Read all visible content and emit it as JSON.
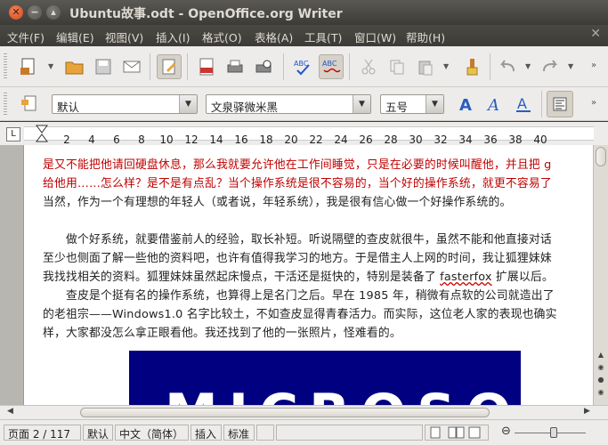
{
  "window": {
    "title": "Ubuntu故事.odt - OpenOffice.org Writer",
    "close_glyph": "✕",
    "minimize_glyph": "−",
    "maximize_glyph": "▴"
  },
  "menubar": {
    "items": [
      "文件(F)",
      "编辑(E)",
      "视图(V)",
      "插入(I)",
      "格式(O)",
      "表格(A)",
      "工具(T)",
      "窗口(W)",
      "帮助(H)"
    ],
    "close_glyph": "✕"
  },
  "formatting": {
    "paragraph_style": "默认",
    "font_name": "文泉驿微米黑",
    "font_size": "五号"
  },
  "ruler": {
    "marks": [
      "2",
      "4",
      "6",
      "8",
      "10",
      "12",
      "14",
      "16",
      "18",
      "20",
      "22",
      "24",
      "26",
      "28",
      "30",
      "32",
      "34",
      "36",
      "38",
      "40"
    ]
  },
  "document": {
    "lines": [
      {
        "text": "是又不能把他请回硬盘休息，那么我就要允许他在工作间睡觉，只是在必要的时候叫醒他，并且把 g",
        "color": "red"
      },
      {
        "text": "给他用……怎么样？是不是有点乱？当个操作系统是很不容易的，当个好的操作系统，就更不容易了",
        "color": "red"
      },
      {
        "text": "当然，作为一个有理想的年轻人（或者说，年轻系统），我是很有信心做一个好操作系统的。",
        "color": "black"
      },
      {
        "text": "",
        "color": "black"
      },
      {
        "text": "　　做个好系统，就要借鉴前人的经验，取长补短。听说隔壁的查皮就很牛，虽然不能和他直接对话",
        "color": "black"
      },
      {
        "text": "至少也侧面了解一些他的资料吧，也许有值得我学习的地方。于是借主人上网的时间，我让狐狸妹妹",
        "color": "black"
      },
      {
        "text_before": "我找找相关的资料。狐狸妹妹虽然起床慢点，干活还是挺快的，特别是装备了 ",
        "text_link": "fasterfox",
        "text_after": " 扩展以后。",
        "color": "black"
      },
      {
        "text": "　　查皮是个挺有名的操作系统，也算得上是名门之后。早在 1985 年，稍微有点软的公司就造出了",
        "color": "black"
      },
      {
        "text": "的老祖宗——Windows1.0 名字比较土，不如查皮显得青春活力。而实际，这位老人家的表现也确实",
        "color": "black"
      },
      {
        "text": "样，大家都没怎么拿正眼看他。我还找到了他的一张照片，怪难看的。",
        "color": "black"
      }
    ],
    "image_text": "MICROSOFT"
  },
  "statusbar": {
    "page": "页面 2 / 117",
    "page_style": "默认",
    "language": "中文（简体）",
    "insert_mode": "插入",
    "selection_mode": "标准",
    "zoom_minus": "⊖",
    "zoom_level": 0.55
  },
  "colors": {
    "titlebar": "#3c3b37",
    "toolbar": "#edeceb",
    "red_text": "#c00000",
    "image_bg": "#000080"
  }
}
